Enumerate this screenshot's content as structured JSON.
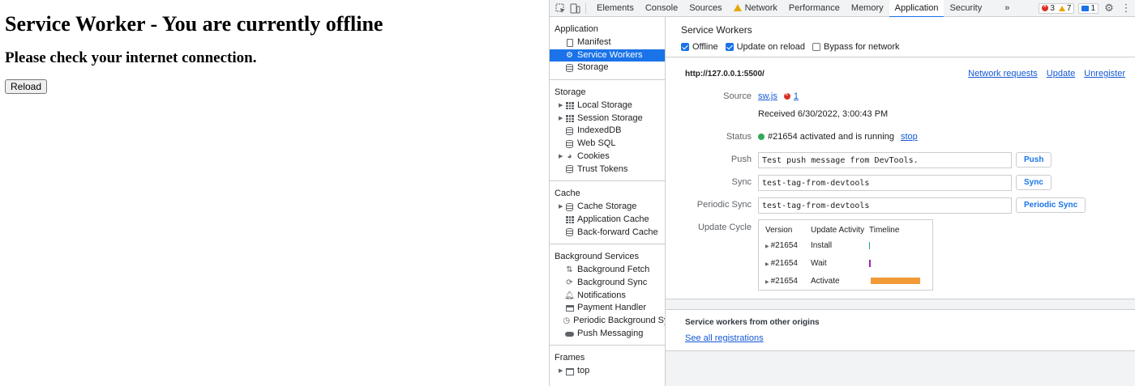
{
  "page": {
    "heading": "Service Worker - You are currently offline",
    "subheading": "Please check your internet connection.",
    "reload_label": "Reload"
  },
  "devtools": {
    "tabs": [
      {
        "label": "Elements"
      },
      {
        "label": "Console"
      },
      {
        "label": "Sources"
      },
      {
        "label": "Network"
      },
      {
        "label": "Performance"
      },
      {
        "label": "Memory"
      },
      {
        "label": "Application"
      },
      {
        "label": "Security"
      }
    ],
    "more_tabs": "»",
    "counts": {
      "errors": "3",
      "warnings": "7",
      "messages": "1"
    },
    "sidebar": {
      "application": {
        "header": "Application",
        "items": [
          {
            "label": "Manifest",
            "icon": "document-icon"
          },
          {
            "label": "Service Workers",
            "icon": "gear-icon"
          },
          {
            "label": "Storage",
            "icon": "database-icon"
          }
        ]
      },
      "storage": {
        "header": "Storage",
        "items": [
          {
            "label": "Local Storage",
            "icon": "grid-icon"
          },
          {
            "label": "Session Storage",
            "icon": "grid-icon"
          },
          {
            "label": "IndexedDB",
            "icon": "database-icon"
          },
          {
            "label": "Web SQL",
            "icon": "database-icon"
          },
          {
            "label": "Cookies",
            "icon": "cookie-icon"
          },
          {
            "label": "Trust Tokens",
            "icon": "database-icon"
          }
        ]
      },
      "cache": {
        "header": "Cache",
        "items": [
          {
            "label": "Cache Storage",
            "icon": "database-icon"
          },
          {
            "label": "Application Cache",
            "icon": "grid-icon"
          },
          {
            "label": "Back-forward Cache",
            "icon": "database-icon"
          }
        ]
      },
      "background": {
        "header": "Background Services",
        "items": [
          {
            "label": "Background Fetch",
            "icon": "up-down-arrows-icon"
          },
          {
            "label": "Background Sync",
            "icon": "sync-icon"
          },
          {
            "label": "Notifications",
            "icon": "bell-icon"
          },
          {
            "label": "Payment Handler",
            "icon": "card-icon"
          },
          {
            "label": "Periodic Background Sync",
            "icon": "clock-icon"
          },
          {
            "label": "Push Messaging",
            "icon": "cloud-icon"
          }
        ]
      },
      "frames": {
        "header": "Frames",
        "items": [
          {
            "label": "top",
            "icon": "frame-icon"
          }
        ]
      }
    },
    "sw": {
      "title": "Service Workers",
      "options": [
        {
          "label": "Offline",
          "checked": true
        },
        {
          "label": "Update on reload",
          "checked": true
        },
        {
          "label": "Bypass for network",
          "checked": false
        }
      ],
      "origin": "http://127.0.0.1:5500/",
      "actions": {
        "network_requests": "Network requests",
        "update": "Update",
        "unregister": "Unregister"
      },
      "source_label": "Source",
      "source_file": "sw.js",
      "source_errors": "1",
      "received": "Received 6/30/2022, 3:00:43 PM",
      "status_label": "Status",
      "status_text": "#21654 activated and is running",
      "status_stop": "stop",
      "push_label": "Push",
      "push_value": "Test push message from DevTools.",
      "push_button": "Push",
      "sync_label": "Sync",
      "sync_value": "test-tag-from-devtools",
      "sync_button": "Sync",
      "periodic_label": "Periodic Sync",
      "periodic_value": "test-tag-from-devtools",
      "periodic_button": "Periodic Sync",
      "update_cycle_label": "Update Cycle",
      "update_cycle": {
        "headers": {
          "version": "Version",
          "activity": "Update Activity",
          "timeline": "Timeline"
        },
        "rows": [
          {
            "version": "#21654",
            "activity": "Install",
            "color": "#1aa39a"
          },
          {
            "version": "#21654",
            "activity": "Wait",
            "color": "#9c27b0"
          },
          {
            "version": "#21654",
            "activity": "Activate",
            "color": "#f29a38"
          }
        ]
      }
    },
    "other": {
      "title": "Service workers from other origins",
      "link": "See all registrations"
    }
  }
}
